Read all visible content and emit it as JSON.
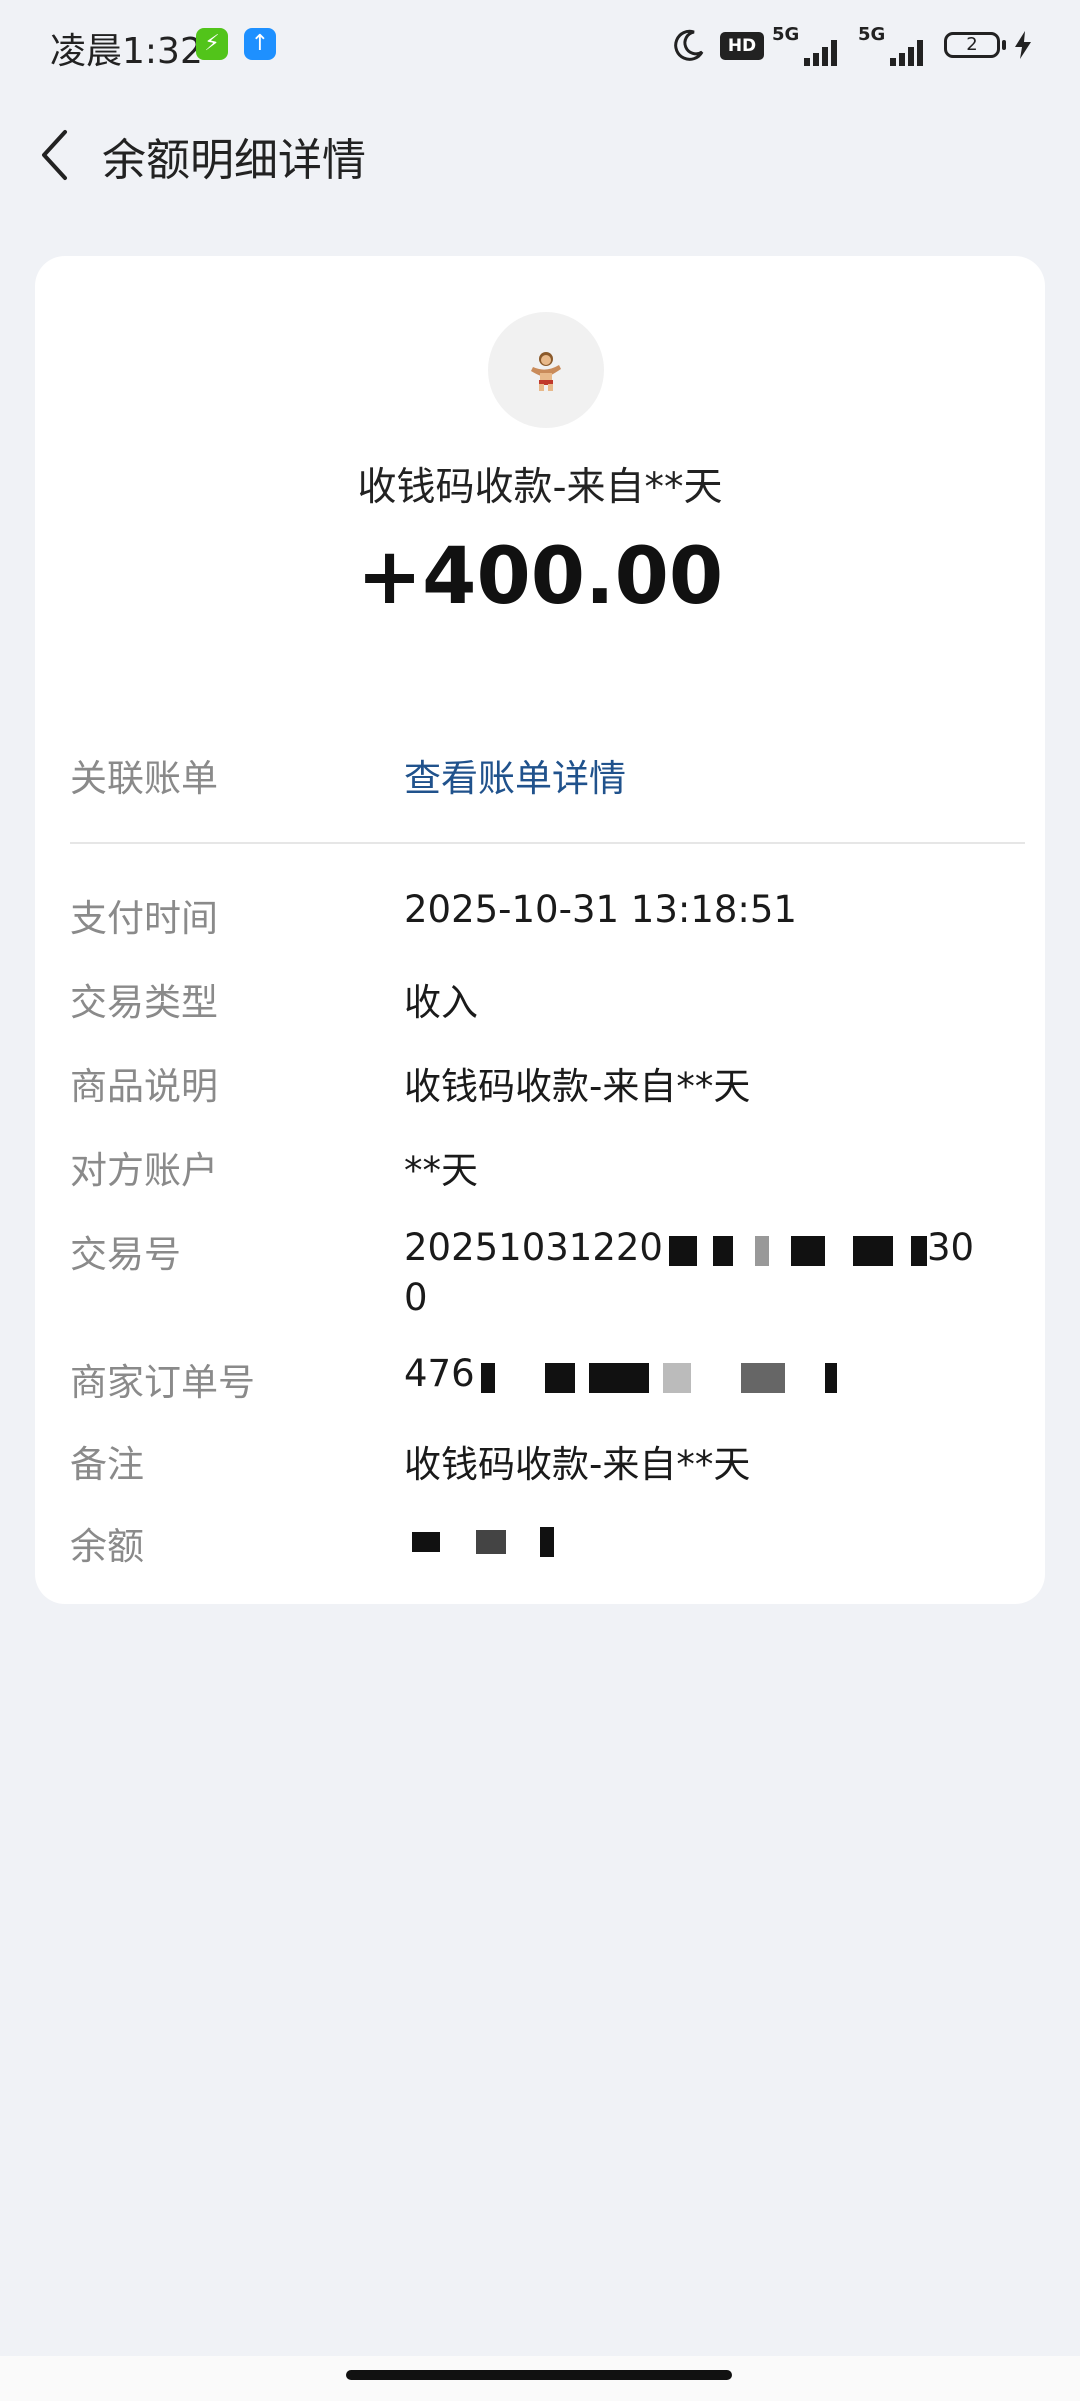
{
  "status_bar": {
    "time": "凌晨1:32",
    "charge_icon": "lightning-icon",
    "upload_icon": "upload-arrow-icon",
    "signal_label_1": "5G",
    "signal_label_2": "5G",
    "hd_label": "HD",
    "battery_level": "2"
  },
  "header": {
    "back_icon": "chevron-left-icon",
    "title": "余额明细详情"
  },
  "card": {
    "avatar_icon": "cartoon-avatar-icon",
    "transaction_title": "收钱码收款-来自**天",
    "amount": "+400.00",
    "related": {
      "label": "关联账单",
      "value": "查看账单详情"
    },
    "details": [
      {
        "label": "支付时间",
        "value": "2025-10-31 13:18:51"
      },
      {
        "label": "交易类型",
        "value": "收入"
      },
      {
        "label": "商品说明",
        "value": "收钱码收款-来自**天"
      },
      {
        "label": "对方账户",
        "value": "**天"
      },
      {
        "label": "交易号",
        "value_visible_start": "20251031220",
        "value_visible_end": "30",
        "value_line2": "0"
      },
      {
        "label": "商家订单号",
        "value_visible_start": "476"
      },
      {
        "label": "备注",
        "value": "收钱码收款-来自**天"
      },
      {
        "label": "余额",
        "value": ""
      }
    ]
  },
  "colors": {
    "background": "#f0f2f6",
    "card": "#ffffff",
    "link": "#20528c",
    "label": "#8a8a8a"
  }
}
